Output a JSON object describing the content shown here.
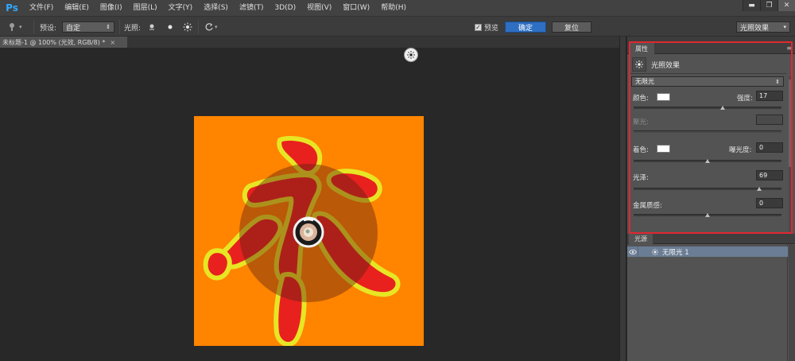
{
  "app": {
    "logo": "Ps"
  },
  "menu": [
    {
      "label": "文件(F)",
      "name": "menu-file"
    },
    {
      "label": "编辑(E)",
      "name": "menu-edit"
    },
    {
      "label": "图像(I)",
      "name": "menu-image"
    },
    {
      "label": "图层(L)",
      "name": "menu-layer"
    },
    {
      "label": "文字(Y)",
      "name": "menu-type"
    },
    {
      "label": "选择(S)",
      "name": "menu-select"
    },
    {
      "label": "滤镜(T)",
      "name": "menu-filter"
    },
    {
      "label": "3D(D)",
      "name": "menu-3d"
    },
    {
      "label": "视图(V)",
      "name": "menu-view"
    },
    {
      "label": "窗口(W)",
      "name": "menu-window"
    },
    {
      "label": "帮助(H)",
      "name": "menu-help"
    }
  ],
  "window_controls": {
    "minimize": "▬",
    "restore": "❐",
    "close": "✕"
  },
  "options": {
    "preset_label": "预设:",
    "preset_value": "自定",
    "lights_label": "光照:",
    "preview_label": "预览",
    "preview_checked": true,
    "ok_label": "确定",
    "reset_label": "复位",
    "workspace_value": "光照效果"
  },
  "document": {
    "tab_title": "未标题-1 @ 100% (光效, RGB/8) *",
    "close": "×"
  },
  "properties": {
    "tab_label": "属性",
    "title": "光照效果",
    "light_type": "无限光",
    "color_label": "颜色:",
    "color_value": "#ffffff",
    "intensity_label": "强度:",
    "intensity_value": "17",
    "intensity_fraction": 0.6,
    "hotspot_label": "聚光:",
    "coloring_label": "着色:",
    "coloring_value": "#ffffff",
    "exposure_label": "曝光度:",
    "exposure_value": "0",
    "exposure_fraction": 0.5,
    "gloss_label": "光泽:",
    "gloss_value": "69",
    "gloss_fraction": 0.85,
    "metallic_label": "金属质感:",
    "metallic_value": "0",
    "metallic_fraction": 0.5
  },
  "lights_panel": {
    "tab_label": "光源",
    "items": [
      {
        "name": "无限光 1"
      }
    ]
  },
  "colors": {
    "canvas_bg": "#ff8400",
    "glyph_fill": "#e8211e",
    "glyph_stroke": "#e7e624",
    "highlight_border": "#e0272f",
    "accent_button": "#2e6fc2"
  }
}
